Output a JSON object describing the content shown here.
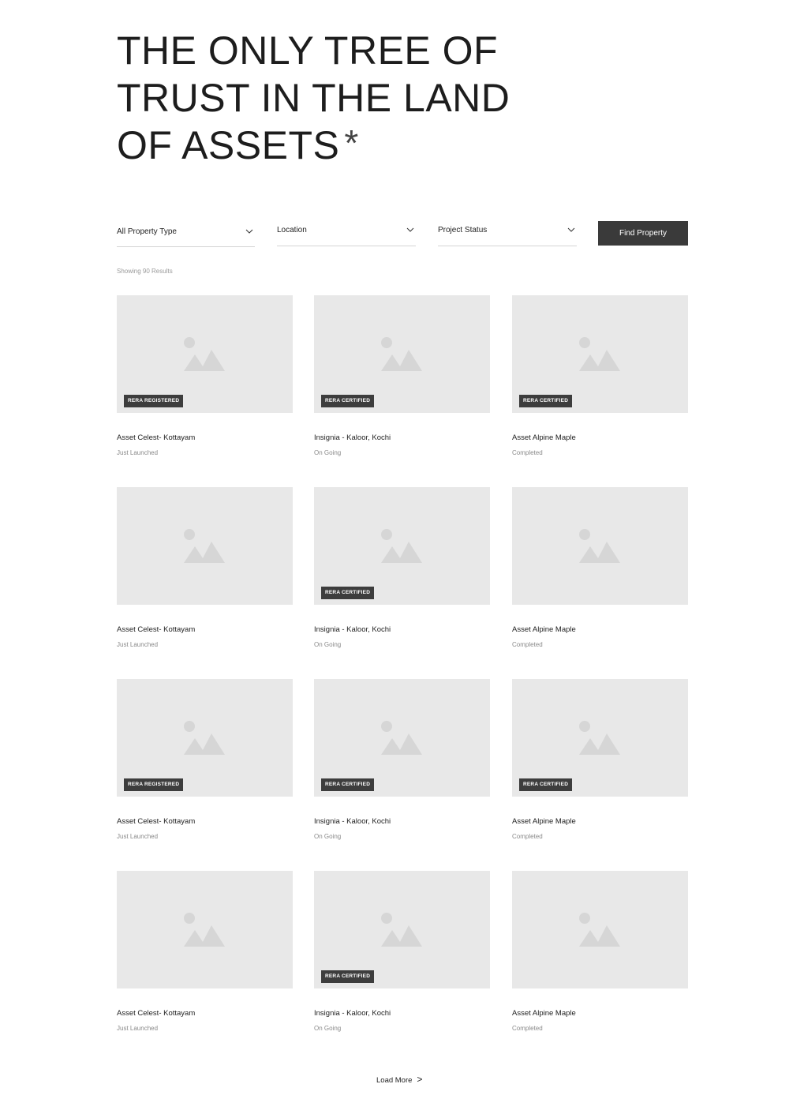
{
  "hero": {
    "lines": [
      "THE ONLY TREE OF",
      "TRUST IN THE LAND",
      "OF ASSETS"
    ],
    "asterisk": "*"
  },
  "filters": {
    "property_type": {
      "value": "All Property Type",
      "icon": "chevron-down-icon"
    },
    "location": {
      "value": "Location",
      "icon": "chevron-down-icon"
    },
    "project_status": {
      "value": "Project Status",
      "icon": "chevron-down-icon"
    },
    "find_button": "Find Property"
  },
  "results_count": "Showing 90 Results",
  "listings": [
    {
      "title": "Asset Celest- Kottayam",
      "status": "Just Launched",
      "badge": "RERA REGISTERED"
    },
    {
      "title": "Insignia - Kaloor, Kochi",
      "status": "On Going",
      "badge": "RERA CERTIFIED"
    },
    {
      "title": "Asset Alpine Maple",
      "status": "Completed",
      "badge": "RERA CERTIFIED"
    },
    {
      "title": "Asset Celest- Kottayam",
      "status": "Just Launched",
      "badge": null
    },
    {
      "title": "Insignia - Kaloor, Kochi",
      "status": "On Going",
      "badge": "RERA CERTIFIED"
    },
    {
      "title": "Asset Alpine Maple",
      "status": "Completed",
      "badge": null
    },
    {
      "title": "Asset Celest- Kottayam",
      "status": "Just Launched",
      "badge": "RERA REGISTERED"
    },
    {
      "title": "Insignia - Kaloor, Kochi",
      "status": "On Going",
      "badge": "RERA CERTIFIED"
    },
    {
      "title": "Asset Alpine Maple",
      "status": "Completed",
      "badge": "RERA CERTIFIED"
    },
    {
      "title": "Asset Celest- Kottayam",
      "status": "Just Launched",
      "badge": null
    },
    {
      "title": "Insignia - Kaloor, Kochi",
      "status": "On Going",
      "badge": "RERA CERTIFIED"
    },
    {
      "title": "Asset Alpine Maple",
      "status": "Completed",
      "badge": null
    }
  ],
  "load_more": {
    "label": "Load More",
    "arrow": ">"
  },
  "colors": {
    "button_bg": "#3a3a3a",
    "badge_bg": "#3d3d3d",
    "placeholder_bg": "#e8e8e8",
    "placeholder_icon": "#d6d6d6"
  }
}
